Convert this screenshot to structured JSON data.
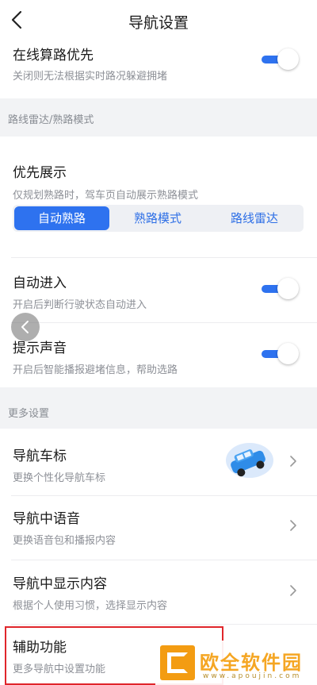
{
  "header": {
    "title": "导航设置"
  },
  "route_priority": {
    "title": "在线算路优先",
    "desc": "关闭则无法根据实时路况躲避拥堵",
    "enabled": true
  },
  "section_radar": {
    "label": "路线雷达/熟路模式"
  },
  "display_priority": {
    "title": "优先展示",
    "desc": "仅规划熟路时，驾车页自动展示熟路模式",
    "options": [
      "自动熟路",
      "熟路模式",
      "路线雷达"
    ],
    "selected": "自动熟路"
  },
  "auto_enter": {
    "title": "自动进入",
    "desc": "开启后判断行驶状态自动进入",
    "enabled": true
  },
  "prompt_sound": {
    "title": "提示声音",
    "desc": "开启后智能播报避堵信息，帮助选路",
    "enabled": true
  },
  "section_more": {
    "label": "更多设置"
  },
  "nav_car_icon": {
    "title": "导航车标",
    "desc": "更换个性化导航车标"
  },
  "nav_voice": {
    "title": "导航中语音",
    "desc": "更换语音包和播报内容"
  },
  "nav_display": {
    "title": "导航中显示内容",
    "desc": "根据个人使用习惯，选择显示内容"
  },
  "assist": {
    "title": "辅助功能",
    "desc": "更多导航中设置功能"
  },
  "watermark": {
    "text": "欧全软件园",
    "url": "www.apoujin.com"
  },
  "colors": {
    "accent": "#2e72ef",
    "highlight": "#e0262b"
  }
}
